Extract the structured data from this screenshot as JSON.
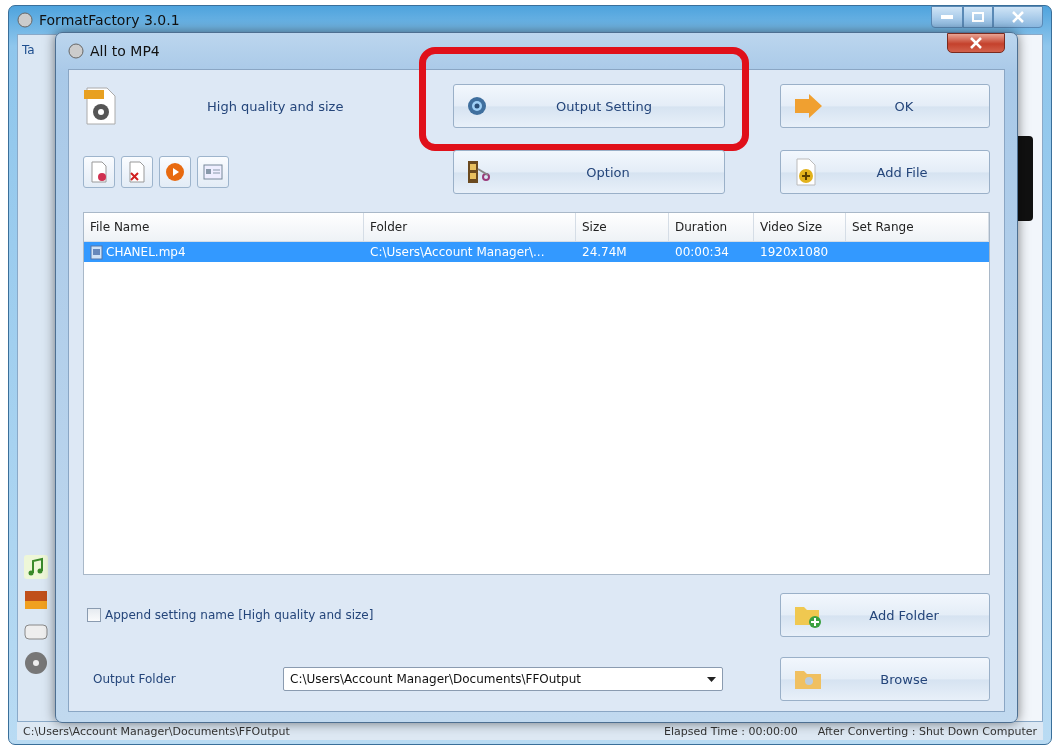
{
  "main_window": {
    "title": "FormatFactory 3.0.1",
    "tab_label": "Ta",
    "status_bar": {
      "output_path": "C:\\Users\\Account Manager\\Documents\\FFOutput",
      "elapsed": "Elapsed Time : 00:00:00",
      "after": "After Converting : Shut Down Computer"
    }
  },
  "dialog": {
    "title": "All to MP4",
    "profile": "High quality and size",
    "buttons": [
      {
        "kind": "gear",
        "label": "Output Setting",
        "highlighted": true
      },
      {
        "kind": "arrow",
        "label": "OK",
        "highlighted": false
      },
      {
        "kind": "film",
        "label": "Option",
        "highlighted": false
      },
      {
        "kind": "addfile",
        "label": "Add File",
        "highlighted": false
      }
    ],
    "table": {
      "columns": [
        "File Name",
        "Folder",
        "Size",
        "Duration",
        "Video Size",
        "Set Range"
      ],
      "rows": [
        {
          "cells": [
            "CHANEL.mp4",
            "C:\\Users\\Account Manager\\...",
            "24.74M",
            "00:00:34",
            "1920x1080",
            ""
          ],
          "selected": true
        }
      ]
    },
    "append_setting": {
      "label": "Append setting name [High quality and size]",
      "checked": false
    },
    "add_folder": "Add Folder",
    "output_folder": {
      "label": "Output Folder",
      "value": "C:\\Users\\Account Manager\\Documents\\FFOutput"
    },
    "browse": "Browse"
  }
}
